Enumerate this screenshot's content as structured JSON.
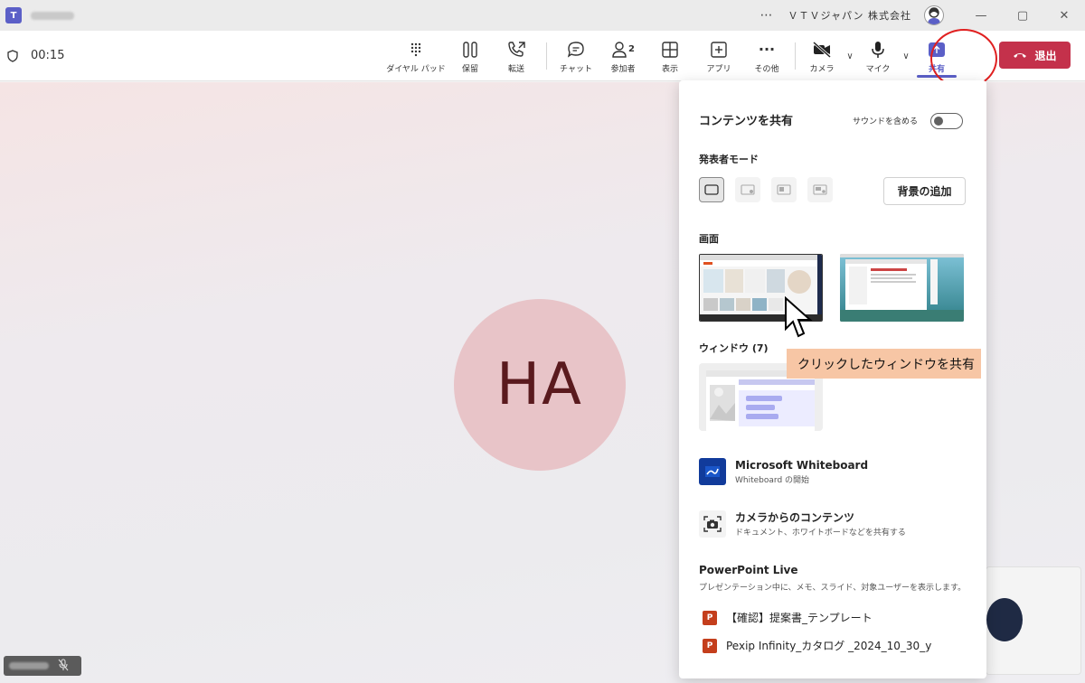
{
  "titlebar": {
    "dots": "⋯",
    "org_name": "ＶＴＶジャパン 株式会社",
    "minimize": "—",
    "maximize": "▢",
    "close": "✕"
  },
  "toolbar": {
    "timer": "00:15",
    "dialpad_label": "ダイヤル パッド",
    "hold_label": "保留",
    "transfer_label": "転送",
    "chat_label": "チャット",
    "people_label": "参加者",
    "people_count": "2",
    "view_label": "表示",
    "apps_label": "アプリ",
    "more_label": "その他",
    "more_glyph": "···",
    "camera_label": "カメラ",
    "mic_label": "マイク",
    "share_label": "共有",
    "leave_label": "退出",
    "caret": "∨"
  },
  "stage": {
    "initials": "HA"
  },
  "share_panel": {
    "title": "コンテンツを共有",
    "sound_label": "サウンドを含める",
    "presenter_mode_label": "発表者モード",
    "add_background": "背景の追加",
    "screen_label": "画面",
    "windows_label": "ウィンドウ (7)",
    "callout": "クリックしたウィンドウを共有",
    "whiteboard_title": "Microsoft Whiteboard",
    "whiteboard_sub": "Whiteboard の開始",
    "camera_content_title": "カメラからのコンテンツ",
    "camera_content_sub": "ドキュメント、ホワイトボードなどを共有する",
    "ppt_title": "PowerPoint Live",
    "ppt_sub": "プレゼンテーション中に、メモ、スライド、対象ユーザーを表示します。",
    "files": [
      {
        "name": "【確認】提案書_テンプレート"
      },
      {
        "name": "Pexip Infinity_カタログ _2024_10_30_y"
      }
    ]
  },
  "colors": {
    "accent": "#5b5fc7",
    "leave": "#c4314b",
    "callout": "#f7c6a5",
    "highlight_circle": "#e02020"
  }
}
